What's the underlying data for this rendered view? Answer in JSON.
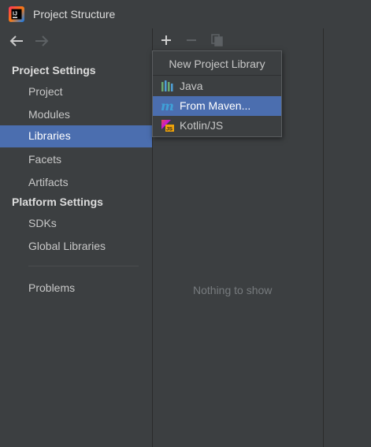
{
  "window": {
    "title": "Project Structure"
  },
  "sidebar": {
    "sections": [
      {
        "header": "Project Settings",
        "items": [
          {
            "label": "Project"
          },
          {
            "label": "Modules"
          },
          {
            "label": "Libraries",
            "selected": true
          },
          {
            "label": "Facets"
          },
          {
            "label": "Artifacts"
          }
        ]
      },
      {
        "header": "Platform Settings",
        "items": [
          {
            "label": "SDKs"
          },
          {
            "label": "Global Libraries"
          }
        ]
      }
    ],
    "problems_label": "Problems"
  },
  "toolbar": {
    "icons": [
      "add-icon",
      "remove-icon",
      "copy-icon"
    ]
  },
  "popup": {
    "title": "New Project Library",
    "items": [
      {
        "label": "Java",
        "icon": "java-library-icon"
      },
      {
        "label": "From Maven...",
        "icon": "maven-icon",
        "selected": true
      },
      {
        "label": "Kotlin/JS",
        "icon": "kotlin-js-icon"
      }
    ]
  },
  "main": {
    "empty_text": "Nothing to show"
  },
  "colors": {
    "background": "#3c3f41",
    "selection": "#4b6eaf",
    "text": "#bbbbbb"
  }
}
